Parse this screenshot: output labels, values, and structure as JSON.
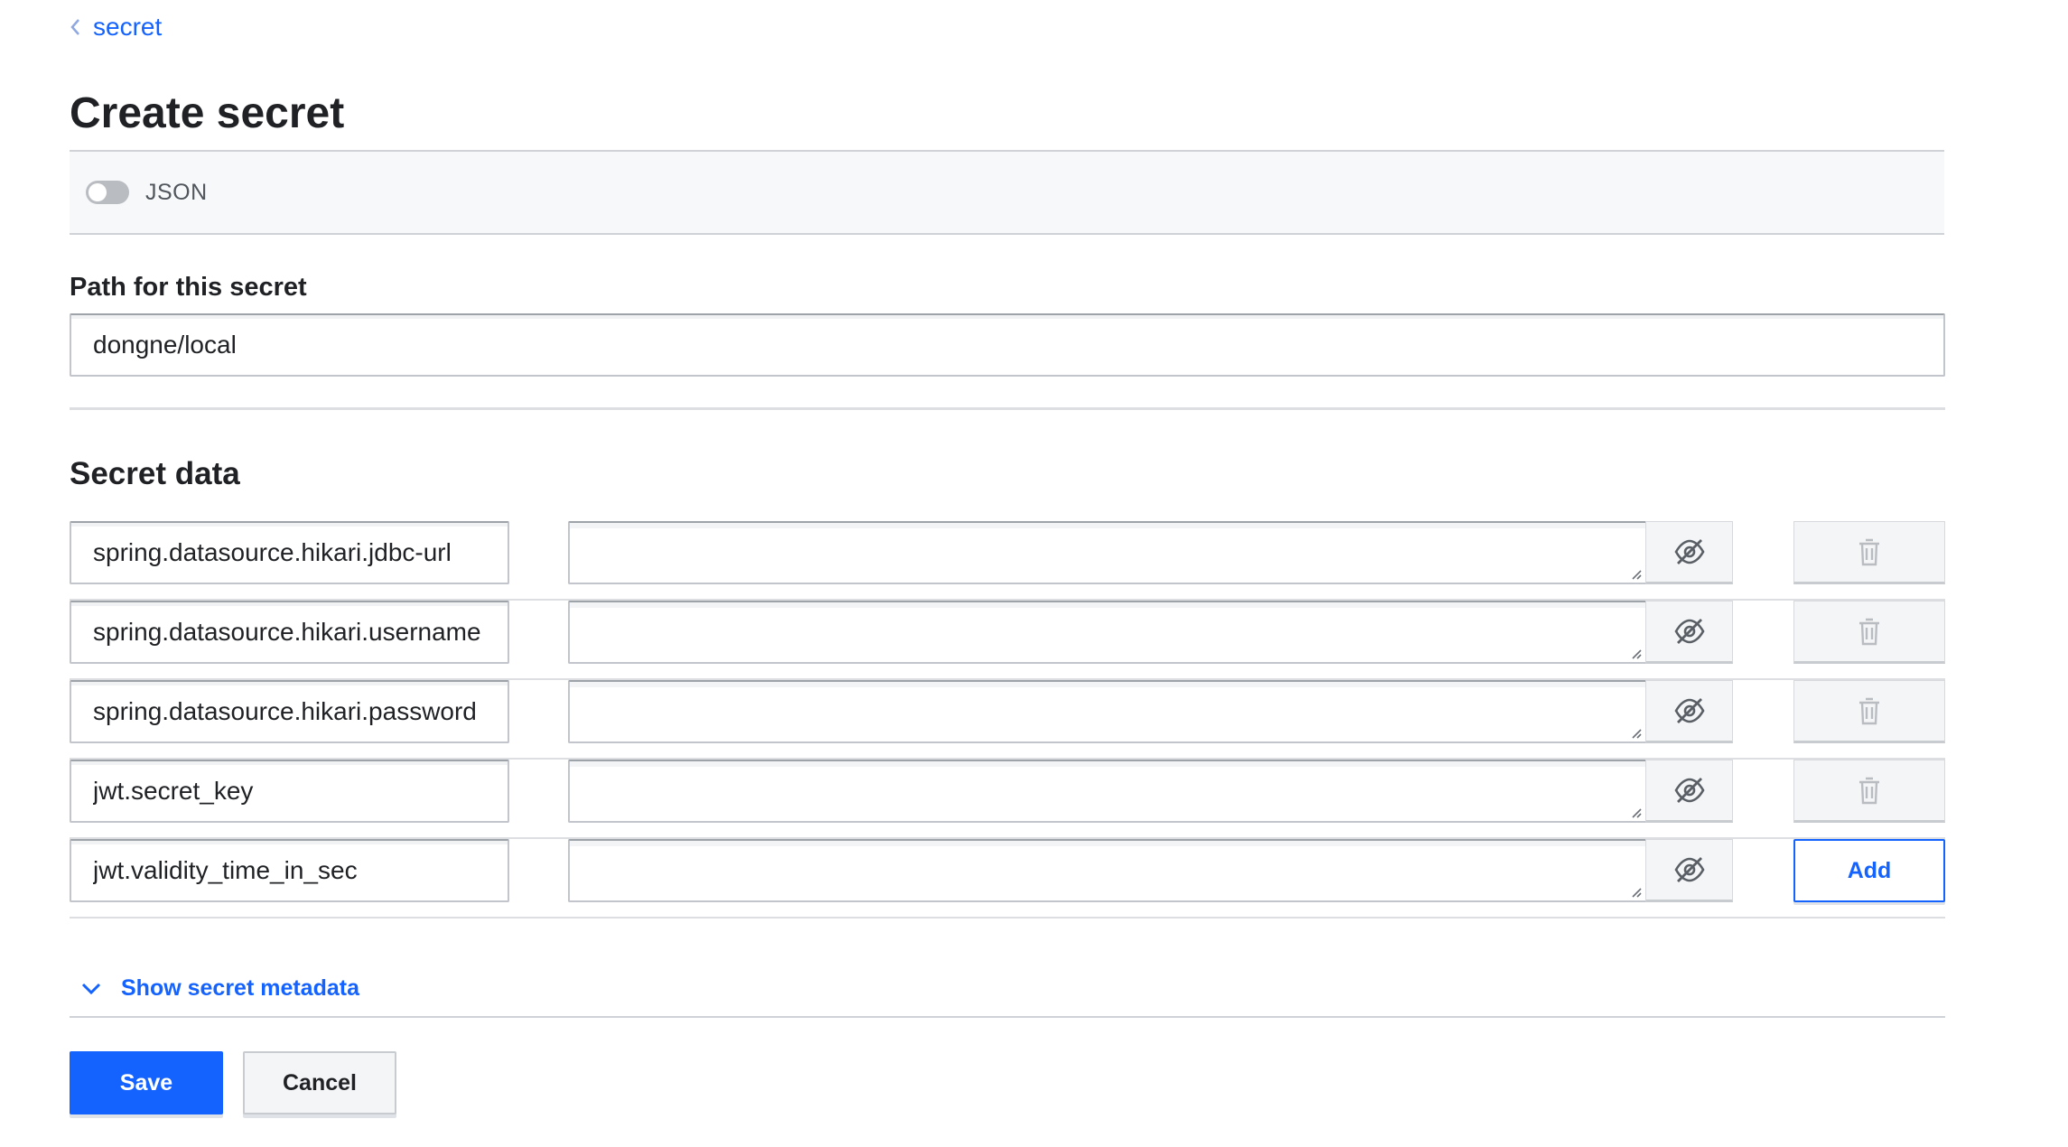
{
  "breadcrumb": {
    "label": "secret",
    "icon": "chevron-left-icon"
  },
  "page": {
    "title": "Create secret"
  },
  "json_toggle": {
    "label": "JSON",
    "enabled": false
  },
  "path": {
    "label": "Path for this secret",
    "value": "dongne/local"
  },
  "secret_data": {
    "title": "Secret data",
    "rows": [
      {
        "key": "spring.datasource.hikari.jdbc-url",
        "value": "",
        "action": "delete"
      },
      {
        "key": "spring.datasource.hikari.username",
        "value": "",
        "action": "delete"
      },
      {
        "key": "spring.datasource.hikari.password",
        "value": "",
        "action": "delete"
      },
      {
        "key": "jwt.secret_key",
        "value": "",
        "action": "delete"
      },
      {
        "key": "jwt.validity_time_in_sec",
        "value": "",
        "action": "add"
      }
    ],
    "add_label": "Add",
    "eye_icon": "eye-off-icon",
    "delete_icon": "trash-icon"
  },
  "metadata": {
    "toggle_label": "Show secret metadata",
    "icon": "chevron-down-icon"
  },
  "actions": {
    "save_label": "Save",
    "cancel_label": "Cancel"
  },
  "colors": {
    "accent": "#1563ff",
    "text": "#1f2124",
    "muted": "#51565c",
    "border": "#c2c5cb"
  }
}
